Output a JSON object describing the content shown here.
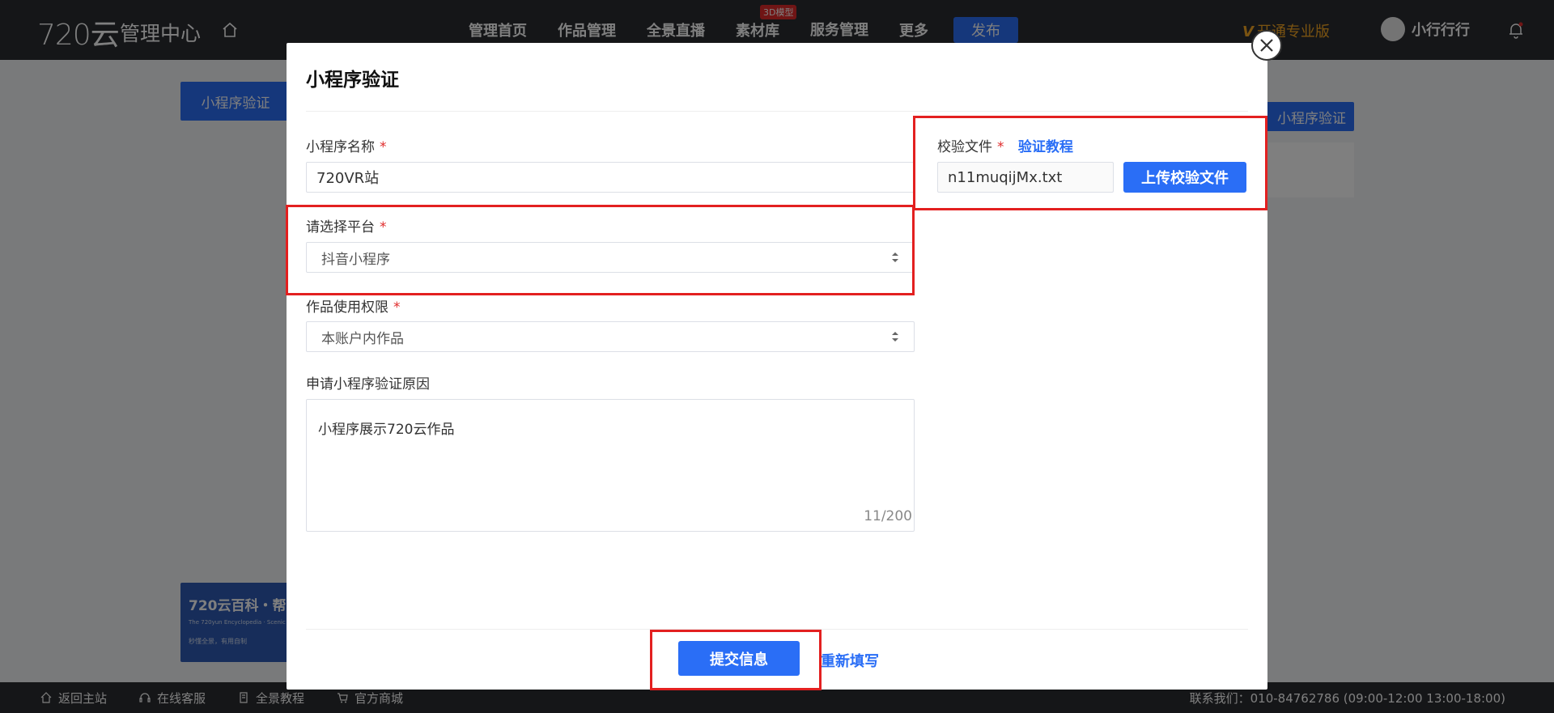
{
  "header": {
    "logo": "720云",
    "subtitle": "管理中心",
    "nav": [
      {
        "label": "管理首页"
      },
      {
        "label": "作品管理"
      },
      {
        "label": "全景直播"
      },
      {
        "label": "素材库",
        "badge": "3D模型"
      },
      {
        "label": "服务管理"
      },
      {
        "label": "更多"
      }
    ],
    "publish_label": "发布",
    "vip_label": "开通专业版",
    "vip_icon": "V",
    "user_name": "小行行行"
  },
  "background": {
    "tab_label": "小程序验证",
    "right_button_label": "小程序验证",
    "banner_title": "720云百科・帮",
    "banner_sub": "The 720yun Encyclopedia · Scenic",
    "banner_desc": "秒懂全景，有用自制"
  },
  "footer": {
    "links": [
      "返回主站",
      "在线客服",
      "全景教程",
      "官方商城"
    ],
    "contact": "联系我们：010-84762786 (09:00-12:00 13:00-18:00)"
  },
  "modal": {
    "title": "小程序验证",
    "name_label": "小程序名称",
    "name_value": "720VR站",
    "platform_label": "请选择平台",
    "platform_value": "抖音小程序",
    "permission_label": "作品使用权限",
    "permission_value": "本账户内作品",
    "reason_label": "申请小程序验证原因",
    "reason_value": "小程序展示720云作品",
    "reason_counter": "11/200",
    "file_label": "校验文件",
    "tutorial_link": "验证教程",
    "file_name": "n11muqijMx.txt",
    "upload_label": "上传校验文件",
    "submit_label": "提交信息",
    "reset_label": "重新填写",
    "required_mark": "*"
  },
  "colors": {
    "accent": "#2a6ef6",
    "highlight": "#e32020",
    "required": "#e02b2b",
    "vip": "#f5a623"
  }
}
